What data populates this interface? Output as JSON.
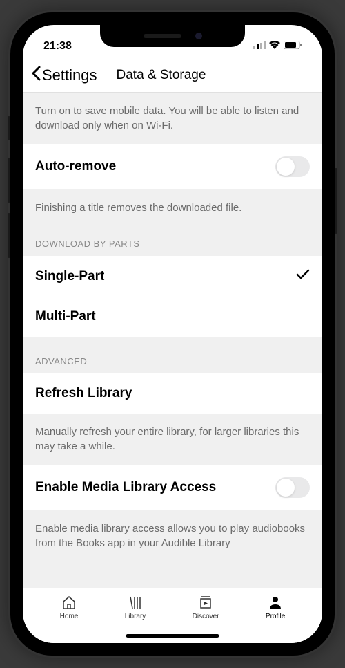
{
  "status": {
    "time": "21:38"
  },
  "nav": {
    "back_label": "Settings",
    "title": "Data & Storage"
  },
  "descriptions": {
    "wifi_only": "Turn on to save mobile data. You will be able to listen and download only when on Wi-Fi.",
    "auto_remove": "Finishing a title removes the downloaded file.",
    "refresh": "Manually refresh your entire library, for larger libraries this may take a while.",
    "media_access": "Enable media library access allows you to play audiobooks from the Books app in your Audible Library"
  },
  "rows": {
    "auto_remove": "Auto-remove",
    "single_part": "Single-Part",
    "multi_part": "Multi-Part",
    "refresh_library": "Refresh Library",
    "enable_media": "Enable Media Library Access"
  },
  "sections": {
    "download_by_parts": "DOWNLOAD BY PARTS",
    "advanced": "ADVANCED"
  },
  "tabs": {
    "home": "Home",
    "library": "Library",
    "discover": "Discover",
    "profile": "Profile"
  }
}
